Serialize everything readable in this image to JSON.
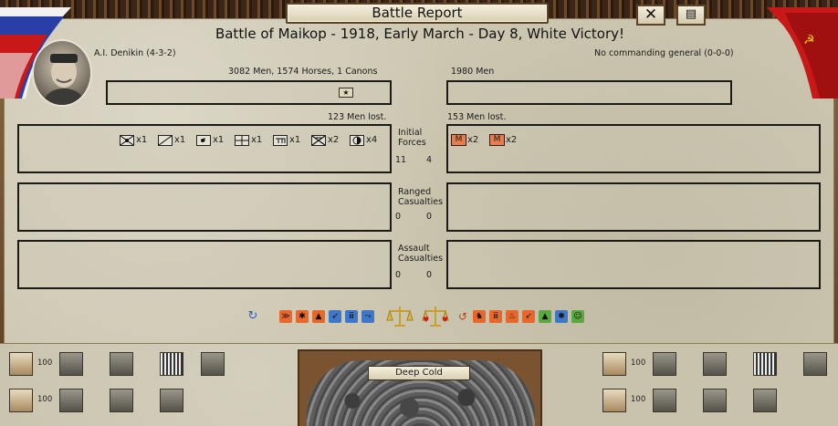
{
  "window": {
    "title": "Battle Report",
    "close_glyph": "✕",
    "log_glyph": "▤"
  },
  "battle": {
    "title": "Battle of Maikop - 1918, Early March - Day 8, White Victory!"
  },
  "attacker": {
    "general": "A.I. Denikin (4-3-2)",
    "strength": "3082 Men, 1574 Horses, 1 Canons",
    "losses": "123 Men lost.",
    "units": [
      {
        "icon": "cavalry-icon",
        "count": "x1"
      },
      {
        "icon": "infantry-icon",
        "count": "x1"
      },
      {
        "icon": "hq-icon",
        "count": "x1"
      },
      {
        "icon": "engineer-icon",
        "count": "x1"
      },
      {
        "icon": "supply-icon",
        "count": "x1"
      },
      {
        "icon": "cavalry-x-icon",
        "count": "x2"
      },
      {
        "icon": "artillery-icon",
        "count": "x4"
      }
    ],
    "initial": "11",
    "ranged": "0",
    "assault": "0",
    "supply_value": "100",
    "ammo_value": "100",
    "flag_color": "#2a3ea8"
  },
  "defender": {
    "general": "No commanding general (0-0-0)",
    "strength": "1980 Men",
    "losses": "153 Men lost.",
    "units": [
      {
        "icon": "militia-icon",
        "label": "M",
        "count": "x2"
      },
      {
        "icon": "militia-icon",
        "label": "M",
        "count": "x2"
      }
    ],
    "initial": "4",
    "ranged": "0",
    "assault": "0",
    "supply_value": "100",
    "ammo_value": "100",
    "flag_color": "#c81818"
  },
  "phases": {
    "initial": "Initial Forces",
    "ranged": "Ranged Casualties",
    "assault": "Assault Casualties"
  },
  "weather": {
    "label": "Deep Cold"
  },
  "colors": {
    "paper": "#cfc9b4",
    "frame": "#6b4a2e",
    "militia": "#e57d4f",
    "tactic_orange": "#e8672a",
    "tactic_blue": "#3f78c8"
  }
}
